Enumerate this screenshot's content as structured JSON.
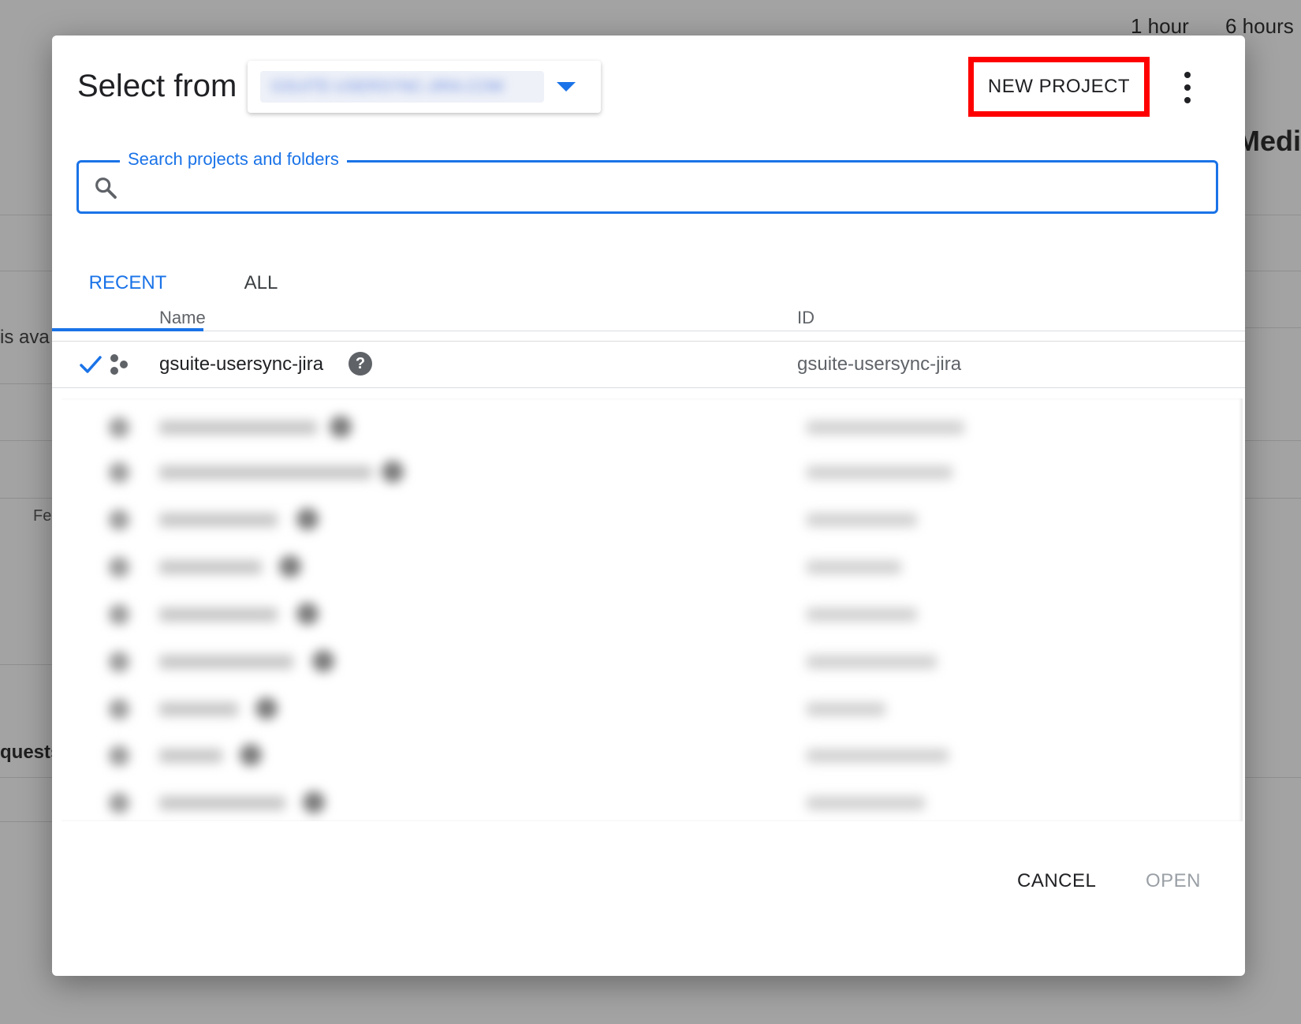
{
  "background": {
    "time_ranges": [
      "1 hour",
      "6 hours"
    ],
    "media_heading": "Media",
    "partial_text_1": "is ava",
    "partial_text_2": "Fe",
    "partial_text_3": "quests"
  },
  "dialog": {
    "title": "Select from",
    "organization": "GSUITE-USERSYNC-JIRA.COM",
    "new_project_label": "NEW PROJECT",
    "search": {
      "label": "Search projects and folders",
      "value": ""
    },
    "tabs": [
      {
        "label": "RECENT",
        "active": true
      },
      {
        "label": "ALL",
        "active": false
      }
    ],
    "table": {
      "columns": [
        "Name",
        "ID"
      ],
      "rows": [
        {
          "name": "gsuite-usersync-jira",
          "id": "gsuite-usersync-jira",
          "selected": true
        }
      ],
      "blurred_row_count": 9
    },
    "buttons": {
      "cancel": "CANCEL",
      "open": "OPEN"
    }
  },
  "colors": {
    "accent": "#1a73e8",
    "highlight_box": "#ff0000",
    "disabled": "#9aa0a6"
  }
}
